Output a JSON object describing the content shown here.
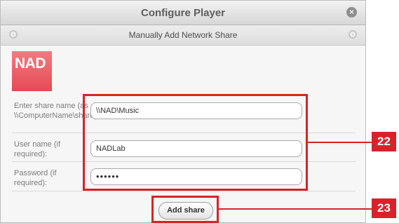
{
  "window": {
    "title": "Configure Player",
    "close_icon": "close-icon"
  },
  "subheader": {
    "title": "Manually Add Network Share",
    "back_icon": "back-arrow-icon",
    "forward_icon": "forward-arrow-icon"
  },
  "brand": {
    "logo_text": "NAD",
    "logo_color": "#e85560"
  },
  "form": {
    "share_label": "Enter share name (as \\\\ComputerName\\share):",
    "share_value": "\\\\NAD\\Music",
    "user_label": "User name (if required):",
    "user_value": "NADLab",
    "password_label": "Password (if required):",
    "password_value": "••••••",
    "submit_label": "Add share"
  },
  "callouts": {
    "fields": "22",
    "button": "23",
    "accent": "#d8222a"
  }
}
